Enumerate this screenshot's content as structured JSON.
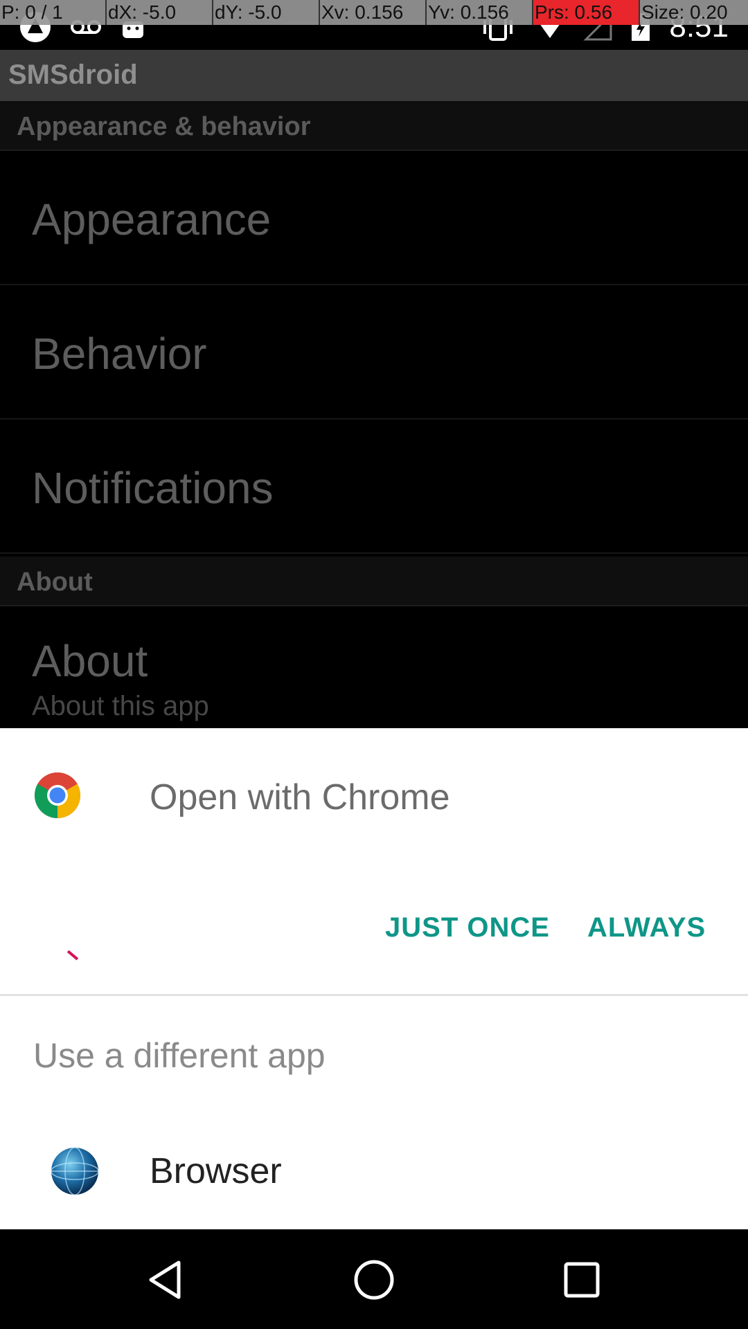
{
  "debug_overlay": {
    "cells": [
      "P: 0 / 1",
      "dX: -5.0",
      "dY: -5.0",
      "Xv: 0.156",
      "Yv: 0.156",
      "Prs: 0.56",
      "Size: 0.20"
    ]
  },
  "status_bar": {
    "time": "8:51",
    "icons_left": [
      "app-notification-icon",
      "voicemail-icon",
      "android-icon"
    ],
    "icons_right": [
      "vibrate-icon",
      "wifi-icon",
      "signal-icon",
      "battery-icon"
    ]
  },
  "app_bar": {
    "title": "SMSdroid"
  },
  "settings": {
    "section1": {
      "header": "Appearance & behavior"
    },
    "items1": [
      {
        "label": "Appearance"
      },
      {
        "label": "Behavior"
      },
      {
        "label": "Notifications"
      }
    ],
    "section2": {
      "header": "About"
    },
    "about": {
      "label": "About",
      "summary": "About this app"
    }
  },
  "sheet": {
    "open_with": "Open with Chrome",
    "just_once": "JUST ONCE",
    "always": "ALWAYS",
    "different_app": "Use a different app",
    "browser": "Browser"
  },
  "colors": {
    "accent": "#0f9688",
    "debug_red": "#e8262b"
  }
}
